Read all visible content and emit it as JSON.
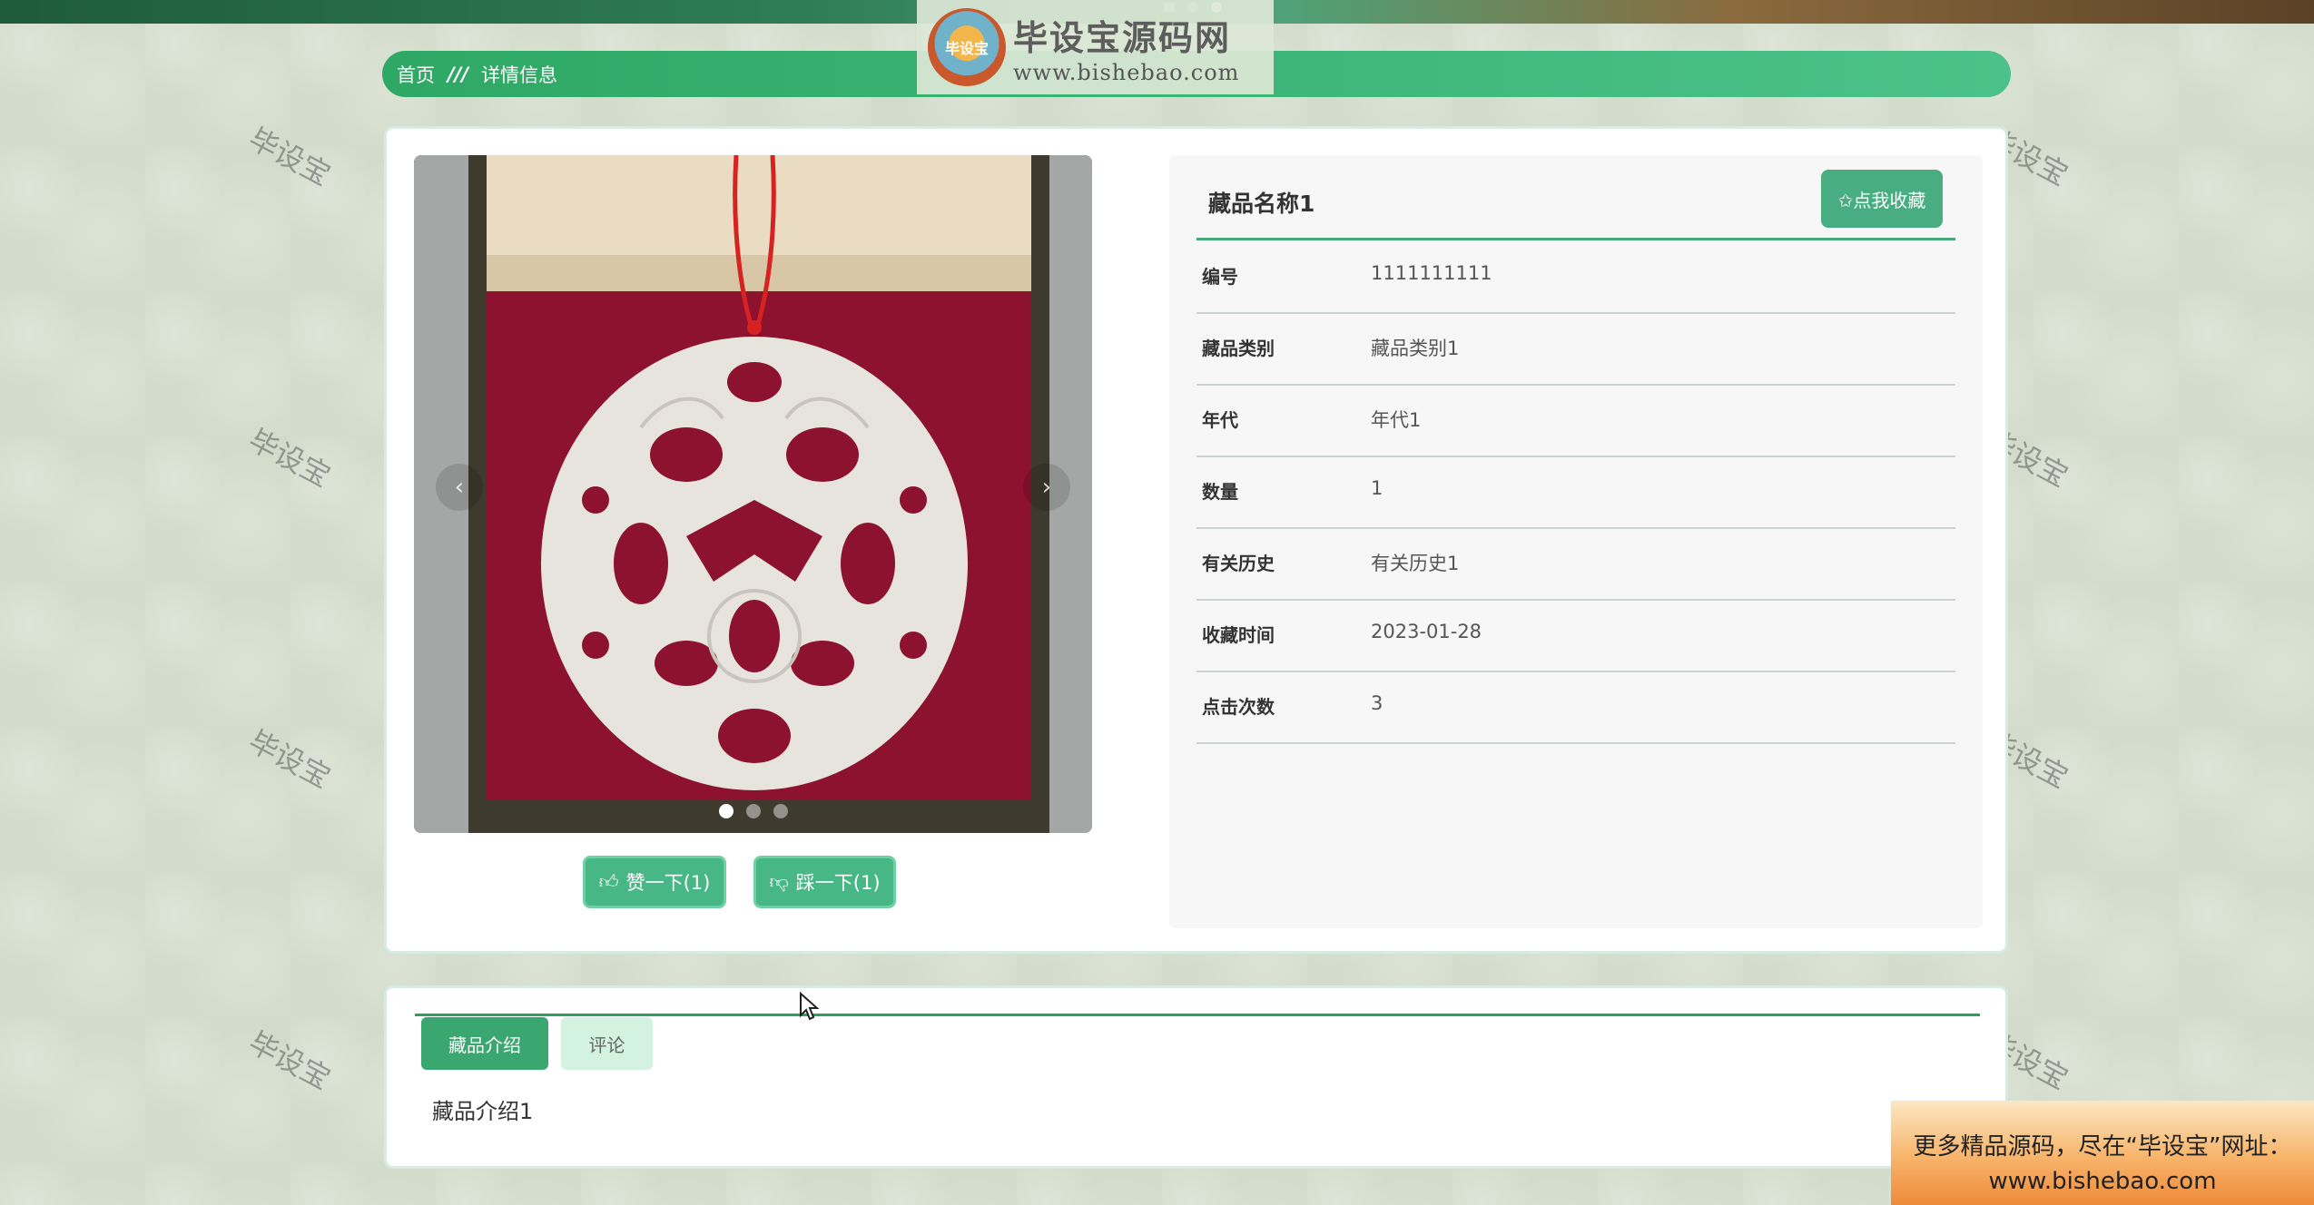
{
  "site": {
    "logo_badge": "毕设宝",
    "logo_title": "毕设宝源码网",
    "logo_url": "www.bishebao.com",
    "watermark": "毕设宝"
  },
  "breadcrumb": {
    "home": "首页",
    "separator": "///",
    "current": "详情信息"
  },
  "carousel": {
    "prev_icon": "‹",
    "next_icon": "›",
    "slide_count": 3,
    "active_index": 0
  },
  "votes": {
    "like_label": "赞一下(1)",
    "dislike_label": "踩一下(1)"
  },
  "item": {
    "title": "藏品名称1",
    "favorite_label": "✩点我收藏",
    "fields": [
      {
        "label": "编号",
        "value": "1111111111"
      },
      {
        "label": "藏品类别",
        "value": "藏品类别1"
      },
      {
        "label": "年代",
        "value": "年代1"
      },
      {
        "label": "数量",
        "value": "1"
      },
      {
        "label": "有关历史",
        "value": "有关历史1"
      },
      {
        "label": "收藏时间",
        "value": "2023-01-28"
      },
      {
        "label": "点击次数",
        "value": "3"
      }
    ]
  },
  "tabs": {
    "items": [
      {
        "label": "藏品介绍",
        "active": true
      },
      {
        "label": "评论",
        "active": false
      }
    ],
    "content": "藏品介绍1"
  },
  "promo": {
    "line1": "更多精品源码，尽在“毕设宝”网址：",
    "line2": "www.bishebao.com"
  },
  "colors": {
    "accent": "#3aa670",
    "breadcrumb_start": "#2ea864",
    "breadcrumb_end": "#4cc28a"
  }
}
